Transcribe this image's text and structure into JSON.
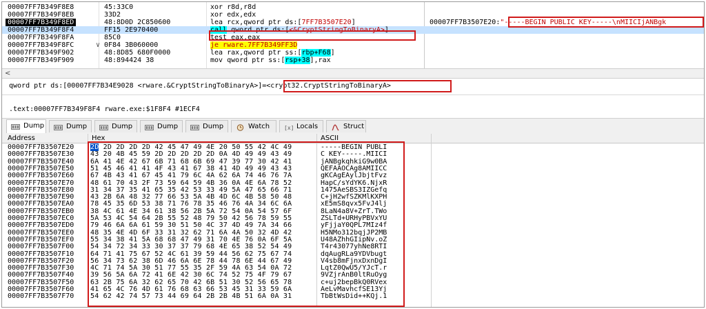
{
  "disasm": {
    "rows": [
      {
        "addr": "00007FF7B349F8E8",
        "bytes": "45:33C0",
        "instr": [
          {
            "t": "xor r8d,r8d"
          }
        ]
      },
      {
        "addr": "00007FF7B349F8EB",
        "bytes": "33D2",
        "instr": [
          {
            "t": "xor edx,edx"
          }
        ]
      },
      {
        "addr": "00007FF7B349F8ED",
        "bytes": "48:8D0D 2C850600",
        "instr": [
          {
            "t": "lea rcx,qword ptr ds:["
          },
          {
            "t": "7FF7B3507E20",
            "c": "reg-addr"
          },
          {
            "t": "]"
          }
        ],
        "comment_addr": "00007FF7B3507E20:",
        "comment_str": "\"-----BEGIN PUBLIC KEY-----\\nMIICIjANBgk"
      },
      {
        "addr": "00007FF7B349F8F4",
        "bytes": "FF15 2E970400",
        "instr": [
          {
            "t": "call",
            "c": "kw-call"
          },
          {
            "t": " qword ptr ds:["
          },
          {
            "t": "<&CryptStringToBinaryA>",
            "c": "reg-addr"
          },
          {
            "t": "]"
          }
        ]
      },
      {
        "addr": "00007FF7B349F8FA",
        "bytes": "85C0",
        "instr": [
          {
            "t": "test eax,eax"
          }
        ]
      },
      {
        "addr": "00007FF7B349F8FC",
        "bytes": "0F84 3B060000",
        "instr": [
          {
            "t": "je rware.7FF7B349FF3D",
            "c": "kw-jmp"
          }
        ]
      },
      {
        "addr": "00007FF7B349F902",
        "bytes": "48:8D85 680F0000",
        "instr": [
          {
            "t": "lea rax,qword ptr ss:["
          },
          {
            "t": "rbp+F68",
            "c": "hl-cyan"
          },
          {
            "t": "]"
          }
        ]
      },
      {
        "addr": "00007FF7B349F909",
        "bytes": "48:894424 38",
        "instr": [
          {
            "t": "mov qword ptr ss:["
          },
          {
            "t": "rsp+38",
            "c": "hl-cyan"
          },
          {
            "t": "],rax"
          }
        ]
      }
    ],
    "scroll_left": "<"
  },
  "info": {
    "line1_prefix": "qword ptr ds:[00007FF7B34E9028 <rware.&CryptStringToBinaryA>]=",
    "line1_value": "<crypt32.CryptStringToBinaryA>",
    "line2": ".text:00007FF7B349F8F4 rware.exe:$1F8F4 #1ECF4"
  },
  "tabs": [
    {
      "label": "Dump 1",
      "icon": "memory-icon"
    },
    {
      "label": "Dump 2",
      "icon": "memory-icon"
    },
    {
      "label": "Dump 3",
      "icon": "memory-icon"
    },
    {
      "label": "Dump 4",
      "icon": "memory-icon"
    },
    {
      "label": "Dump 5",
      "icon": "memory-icon"
    },
    {
      "label": "Watch 1",
      "icon": "watch-icon"
    },
    {
      "label": "Locals",
      "icon": "locals-icon"
    },
    {
      "label": "Struct",
      "icon": "struct-icon"
    }
  ],
  "dump": {
    "headers": {
      "address": "Address",
      "hex": "Hex",
      "ascii": "ASCII"
    },
    "rows": [
      {
        "addr": "00007FF7B3507E20",
        "hex": "2D 2D 2D 2D 2D 42 45 47 49 4E 20 50 55 42 4C 49",
        "ascii": "-----BEGIN PUBLI"
      },
      {
        "addr": "00007FF7B3507E30",
        "hex": "43 20 4B 45 59 2D 2D 2D 2D 2D 0A 4D 49 49 43 49",
        "ascii": "C KEY-----.MIICI"
      },
      {
        "addr": "00007FF7B3507E40",
        "hex": "6A 41 4E 42 67 6B 71 68 6B 69 47 39 77 30 42 41",
        "ascii": "jANBgkqhkiG9w0BA"
      },
      {
        "addr": "00007FF7B3507E50",
        "hex": "51 45 46 41 41 4F 43 41 67 38 41 4D 49 49 43 43",
        "ascii": "QEFAAOCAg8AMIICC"
      },
      {
        "addr": "00007FF7B3507E60",
        "hex": "67 4B 43 41 67 45 41 79 6C 4A 62 6A 74 46 76 7A",
        "ascii": "gKCAgEAylJbjtFvz"
      },
      {
        "addr": "00007FF7B3507E70",
        "hex": "48 61 70 43 2F 73 59 64 59 4B 36 0A 4E 6A 78 52",
        "ascii": "HapC/sYdYK6.NjxR"
      },
      {
        "addr": "00007FF7B3507E80",
        "hex": "31 34 37 35 41 65 35 42 53 33 49 5A 47 65 66 71",
        "ascii": "1475AeSBS3IZGefq"
      },
      {
        "addr": "00007FF7B3507E90",
        "hex": "43 2B 6A 48 32 77 66 53 5A 4B 4D 6C 4B 58 50 48",
        "ascii": "C+jH2wfSZKMlKXPH"
      },
      {
        "addr": "00007FF7B3507EA0",
        "hex": "78 45 35 6D 53 38 71 76 78 35 46 76 4A 34 6C 6A",
        "ascii": "xE5mS8qvx5FvJ4lj"
      },
      {
        "addr": "00007FF7B3507EB0",
        "hex": "38 4C 61 4E 34 61 38 56 2B 5A 72 54 0A 54 57 6F",
        "ascii": "8LaN4a8V+ZrT.TWo"
      },
      {
        "addr": "00007FF7B3507EC0",
        "hex": "5A 53 4C 54 64 2B 55 52 48 79 50 42 56 78 59 55",
        "ascii": "ZSLTd+URHyPBVxYU"
      },
      {
        "addr": "00007FF7B3507ED0",
        "hex": "79 46 6A 6A 61 59 30 51 50 4C 37 4D 49 7A 34 66",
        "ascii": "yFjjaY0QPL7MIz4f"
      },
      {
        "addr": "00007FF7B3507EE0",
        "hex": "48 35 4E 4D 6F 33 31 32 62 71 6A 4A 50 32 4D 42",
        "ascii": "H5NMo312bqjJP2MB"
      },
      {
        "addr": "00007FF7B3507EF0",
        "hex": "55 34 38 41 5A 68 68 47 49 31 70 4E 76 0A 6F 5A",
        "ascii": "U48AZhhGIipNv.oZ"
      },
      {
        "addr": "00007FF7B3507F00",
        "hex": "54 34 72 34 33 30 37 37 79 68 4E 65 38 52 54 49",
        "ascii": "T4r43077yhNe8RTI"
      },
      {
        "addr": "00007FF7B3507F10",
        "hex": "64 71 41 75 67 52 4C 61 39 59 44 56 62 75 67 74",
        "ascii": "dqAugRLa9YDVbugt"
      },
      {
        "addr": "00007FF7B3507F20",
        "hex": "56 34 73 62 38 6D 46 6A 6E 78 44 78 6E 44 67 49",
        "ascii": "V4sb8mFjnxDxnDgI"
      },
      {
        "addr": "00007FF7B3507F30",
        "hex": "4C 71 74 5A 30 51 77 55 35 2F 59 4A 63 54 0A 72",
        "ascii": "LqtZ0QwU5/YJcT.r"
      },
      {
        "addr": "00007FF7B3507F40",
        "hex": "39 56 5A 6A 72 41 6E 42 30 6C 74 52 75 4F 79 67",
        "ascii": "9VZjrAnB0ltRuOyg"
      },
      {
        "addr": "00007FF7B3507F50",
        "hex": "63 2B 75 6A 32 62 65 70 42 6B 51 30 52 56 65 78",
        "ascii": "c+uj2bepBkQ0RVex"
      },
      {
        "addr": "00007FF7B3507F60",
        "hex": "41 65 4C 76 4D 61 76 68 63 66 53 45 31 33 59 6A",
        "ascii": "AeLvMavhcfSE13Yj"
      },
      {
        "addr": "00007FF7B3507F70",
        "hex": "54 62 42 74 57 73 44 69 64 2B 2B 4B 51 6A 0A 31",
        "ascii": "TbBtWsDid++KQj.1"
      }
    ]
  }
}
